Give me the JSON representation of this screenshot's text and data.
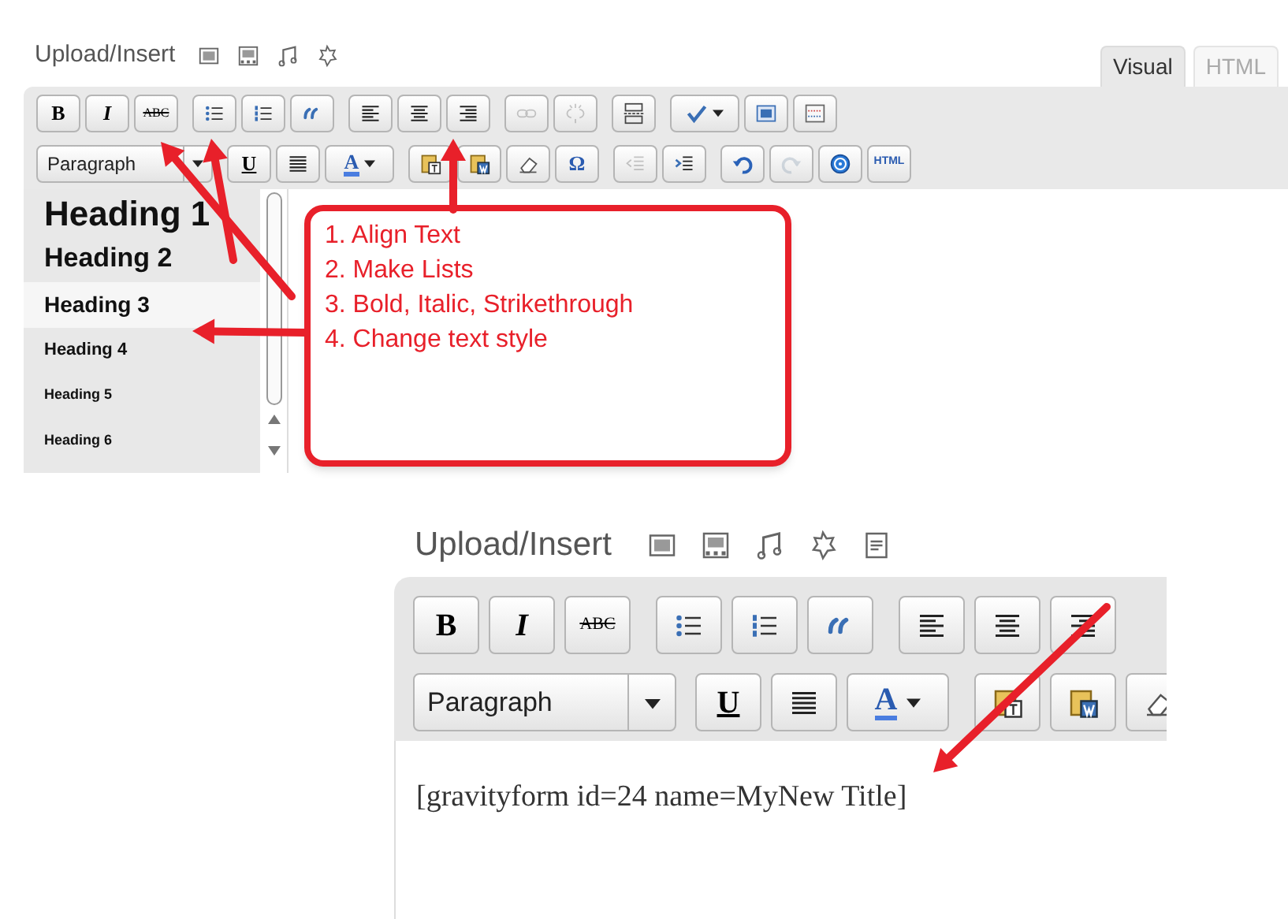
{
  "top_editor": {
    "upload_label": "Upload/Insert",
    "media_buttons": [
      {
        "kind": "image"
      },
      {
        "kind": "gallery"
      },
      {
        "kind": "music"
      },
      {
        "kind": "star"
      }
    ],
    "tabs": [
      {
        "label": "Visual",
        "selected": true
      },
      {
        "label": "HTML",
        "selected": false
      }
    ],
    "toolbar_row_1": [
      {
        "kind": "bold",
        "label": "B",
        "disabled": false
      },
      {
        "kind": "italic",
        "label": "I",
        "disabled": false
      },
      {
        "kind": "strike",
        "label": "ABC",
        "disabled": false
      },
      {
        "kind": "ul",
        "disabled": false
      },
      {
        "kind": "ol",
        "disabled": false
      },
      {
        "kind": "quote",
        "disabled": false
      },
      {
        "kind": "alignl",
        "disabled": false
      },
      {
        "kind": "alignc",
        "disabled": false
      },
      {
        "kind": "alignr",
        "disabled": false
      },
      {
        "kind": "link",
        "disabled": true
      },
      {
        "kind": "unlink",
        "disabled": true
      },
      {
        "kind": "more",
        "disabled": false
      },
      {
        "kind": "spell",
        "disabled": false
      },
      {
        "kind": "fullscreen",
        "disabled": false
      },
      {
        "kind": "kitchen",
        "disabled": false
      }
    ],
    "format_select": {
      "value": "Paragraph"
    },
    "toolbar_row_2": [
      {
        "kind": "underline",
        "label": "U",
        "disabled": false
      },
      {
        "kind": "justify",
        "disabled": false
      },
      {
        "kind": "color",
        "label": "A",
        "disabled": false
      },
      {
        "kind": "pastetext",
        "disabled": false
      },
      {
        "kind": "pasteword",
        "disabled": false
      },
      {
        "kind": "eraser",
        "disabled": false
      },
      {
        "kind": "omega",
        "label": "Ω",
        "disabled": false
      },
      {
        "kind": "outdent",
        "disabled": true
      },
      {
        "kind": "indent",
        "disabled": false
      },
      {
        "kind": "undo",
        "disabled": false
      },
      {
        "kind": "redo",
        "disabled": true
      },
      {
        "kind": "help",
        "disabled": false
      },
      {
        "kind": "html",
        "label": "HTML",
        "disabled": false
      }
    ],
    "format_options": [
      {
        "label": "Heading 1",
        "selected": false
      },
      {
        "label": "Heading 2",
        "selected": false
      },
      {
        "label": "Heading 3",
        "selected": true
      },
      {
        "label": "Heading 4",
        "selected": false
      },
      {
        "label": "Heading 5",
        "selected": false
      },
      {
        "label": "Heading 6",
        "selected": false
      }
    ],
    "callout": {
      "lines": [
        "1. Align Text",
        "2. Make Lists",
        "3. Bold, Italic, Strikethrough",
        "4. Change text style"
      ]
    }
  },
  "bottom_editor": {
    "upload_label": "Upload/Insert",
    "media_buttons": [
      {
        "kind": "image"
      },
      {
        "kind": "gallery"
      },
      {
        "kind": "music"
      },
      {
        "kind": "star"
      },
      {
        "kind": "form"
      }
    ],
    "toolbar_row_1": [
      {
        "kind": "bold",
        "label": "B",
        "disabled": false
      },
      {
        "kind": "italic",
        "label": "I",
        "disabled": false
      },
      {
        "kind": "strike",
        "label": "ABC",
        "disabled": false
      },
      {
        "kind": "ul",
        "disabled": false
      },
      {
        "kind": "ol",
        "disabled": false
      },
      {
        "kind": "quote",
        "disabled": false
      },
      {
        "kind": "alignl",
        "disabled": false
      },
      {
        "kind": "alignc",
        "disabled": false
      },
      {
        "kind": "alignr",
        "disabled": false
      }
    ],
    "format_select": {
      "value": "Paragraph"
    },
    "toolbar_row_2": [
      {
        "kind": "underline",
        "label": "U",
        "disabled": false
      },
      {
        "kind": "justify",
        "disabled": false
      },
      {
        "kind": "color",
        "label": "A",
        "disabled": false
      },
      {
        "kind": "pastetext",
        "disabled": false
      },
      {
        "kind": "pasteword",
        "disabled": false
      },
      {
        "kind": "eraser",
        "disabled": false
      }
    ],
    "content": "[gravityform id=24 name=MyNew Title]"
  }
}
